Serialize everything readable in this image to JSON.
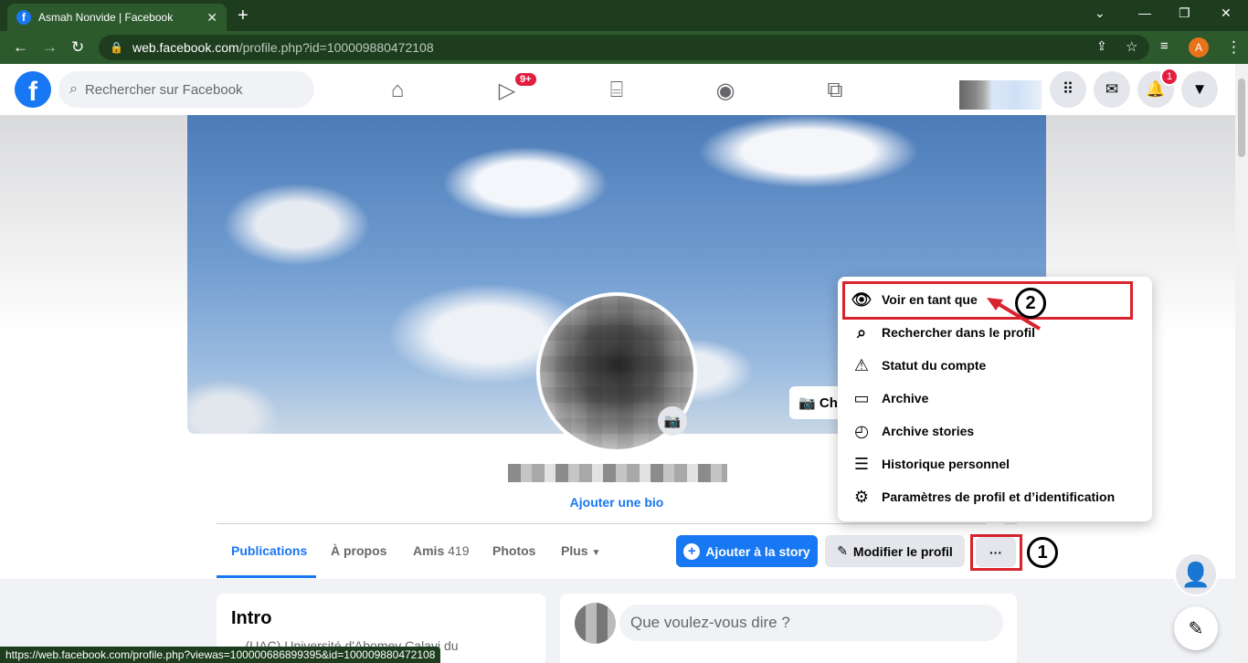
{
  "browser": {
    "tab_title": "Asmah Nonvide | Facebook",
    "favicon": "f",
    "url_host": "web.facebook.com",
    "url_path": "/profile.php?id=100009880472108",
    "profile_initial": "A",
    "status_url": "https://web.facebook.com/profile.php?viewas=100000686899395&id=100009880472108"
  },
  "header": {
    "logo": "f",
    "search_placeholder": "Rechercher sur Facebook",
    "watch_badge": "9+",
    "notif_badge": "1"
  },
  "profile": {
    "cover_button_label": "Cha",
    "add_bio": "Ajouter une bio"
  },
  "tabs": {
    "publications": "Publications",
    "about": "À propos",
    "friends": "Amis",
    "friends_count": "419",
    "photos": "Photos",
    "more": "Plus"
  },
  "actions": {
    "add_story": "Ajouter à la story",
    "edit_profile": "Modifier le profil",
    "more": "···"
  },
  "menu": {
    "items": [
      {
        "label": "Voir en tant que",
        "icon": "eye-icon"
      },
      {
        "label": "Rechercher dans le profil",
        "icon": "search-icon"
      },
      {
        "label": "Statut du compte",
        "icon": "warning-icon"
      },
      {
        "label": "Archive",
        "icon": "archive-icon"
      },
      {
        "label": "Archive stories",
        "icon": "history-icon"
      },
      {
        "label": "Historique personnel",
        "icon": "list-icon"
      },
      {
        "label": "Paramètres de profil et d’identification",
        "icon": "settings-icon"
      }
    ]
  },
  "annotations": {
    "step1": "1",
    "step2": "2"
  },
  "content": {
    "intro_title": "Intro",
    "intro_text": "... (UAC) Université d'Abomey Calavi du",
    "composer_placeholder": "Que voulez-vous dire ?"
  },
  "colors": {
    "brand": "#1877f2",
    "annotation_red": "#d9232d",
    "browser_green": "#2c5a2d"
  }
}
